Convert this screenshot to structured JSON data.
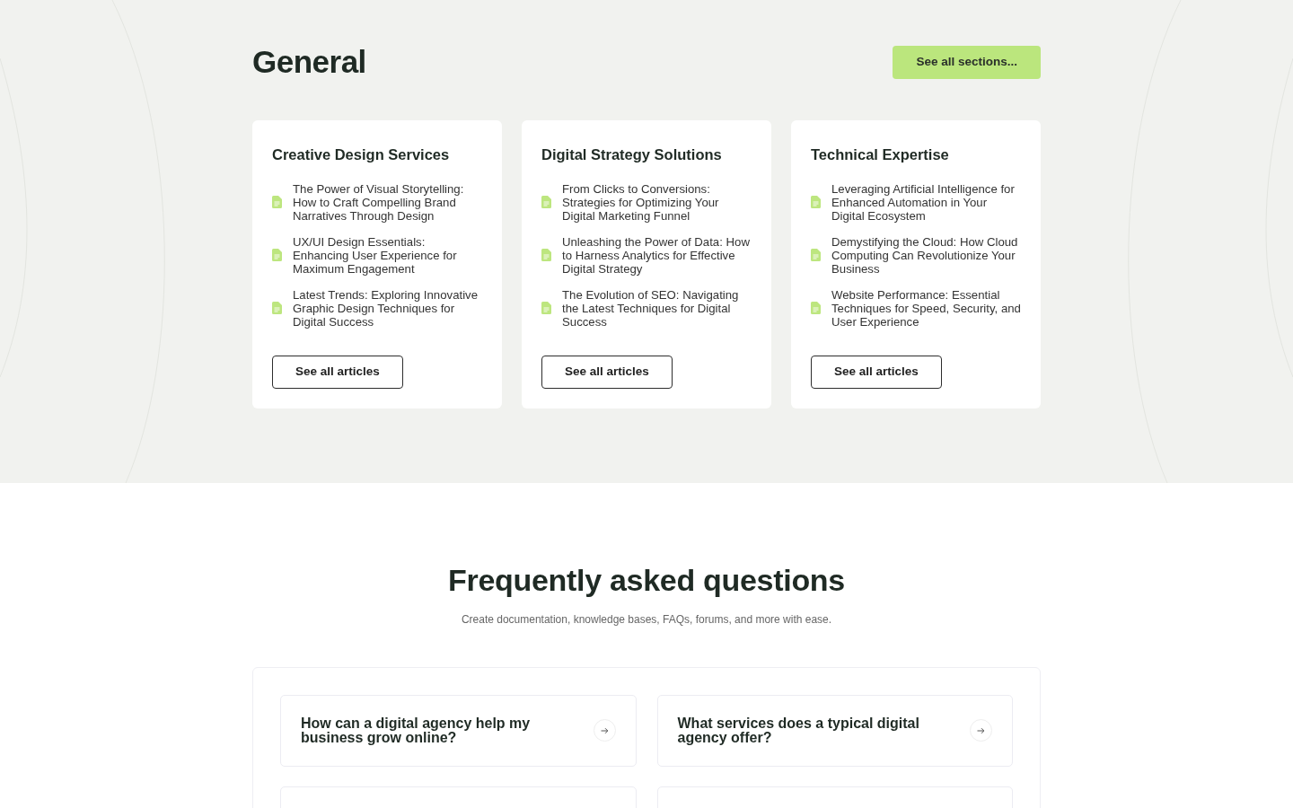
{
  "general": {
    "title": "General",
    "see_all_button": "See all sections...",
    "categories": [
      {
        "title": "Creative Design Services",
        "articles": [
          "The Power of Visual Storytelling: How to Craft Compelling Brand Narratives Through Design",
          "UX/UI Design Essentials: Enhancing User Experience for Maximum Engagement",
          "Latest Trends: Exploring Innovative Graphic Design Techniques for Digital Success"
        ],
        "button": "See all articles"
      },
      {
        "title": "Digital Strategy Solutions",
        "articles": [
          "From Clicks to Conversions: Strategies for Optimizing Your Digital Marketing Funnel",
          "Unleashing the Power of Data: How to Harness Analytics for Effective Digital Strategy",
          "The Evolution of SEO: Navigating the Latest Techniques for Digital Success"
        ],
        "button": "See all articles"
      },
      {
        "title": "Technical Expertise",
        "articles": [
          "Leveraging Artificial Intelligence for Enhanced Automation in Your Digital Ecosystem",
          "Demystifying the Cloud: How Cloud Computing Can Revolutionize Your Business",
          "Website Performance: Essential Techniques for Speed, Security, and User Experience"
        ],
        "button": "See all articles"
      }
    ]
  },
  "faq": {
    "title": "Frequently asked questions",
    "subtitle": "Create documentation, knowledge bases, FAQs, forums, and more with ease.",
    "questions": [
      {
        "kind": "question",
        "text": "How can a digital agency help my business grow online?"
      },
      {
        "kind": "question",
        "text": "What services does a typical digital agency offer?"
      },
      {
        "kind": "cut_off"
      },
      {
        "kind": "cut_off"
      }
    ]
  }
}
